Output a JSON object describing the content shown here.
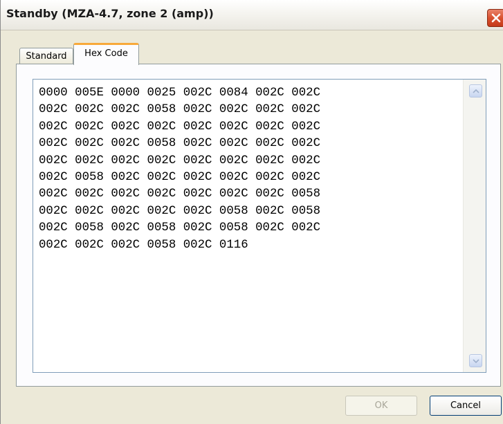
{
  "window": {
    "title": "Standby (MZA-4.7, zone 2 (amp))"
  },
  "tabs": [
    {
      "label": "Standard",
      "selected": false
    },
    {
      "label": "Hex Code",
      "selected": true
    }
  ],
  "hex_code": {
    "lines": [
      "0000 005E 0000 0025 002C 0084 002C 002C",
      "002C 002C 002C 0058 002C 002C 002C 002C",
      "002C 002C 002C 002C 002C 002C 002C 002C",
      "002C 002C 002C 0058 002C 002C 002C 002C",
      "002C 002C 002C 002C 002C 002C 002C 002C",
      "002C 0058 002C 002C 002C 002C 002C 002C",
      "002C 002C 002C 002C 002C 002C 002C 0058",
      "002C 002C 002C 002C 002C 0058 002C 0058",
      "002C 0058 002C 0058 002C 0058 002C 002C",
      "002C 002C 002C 0058 002C 0116"
    ]
  },
  "buttons": {
    "ok_label": "OK",
    "ok_enabled": false,
    "cancel_label": "Cancel"
  },
  "icons": {
    "close": "close-icon",
    "scroll_up": "chevron-up-icon",
    "scroll_down": "chevron-down-icon"
  },
  "colors": {
    "close_button": "#d9512f",
    "selected_tab_accent": "#f8a93a",
    "dialog_background": "#ece9d8"
  }
}
